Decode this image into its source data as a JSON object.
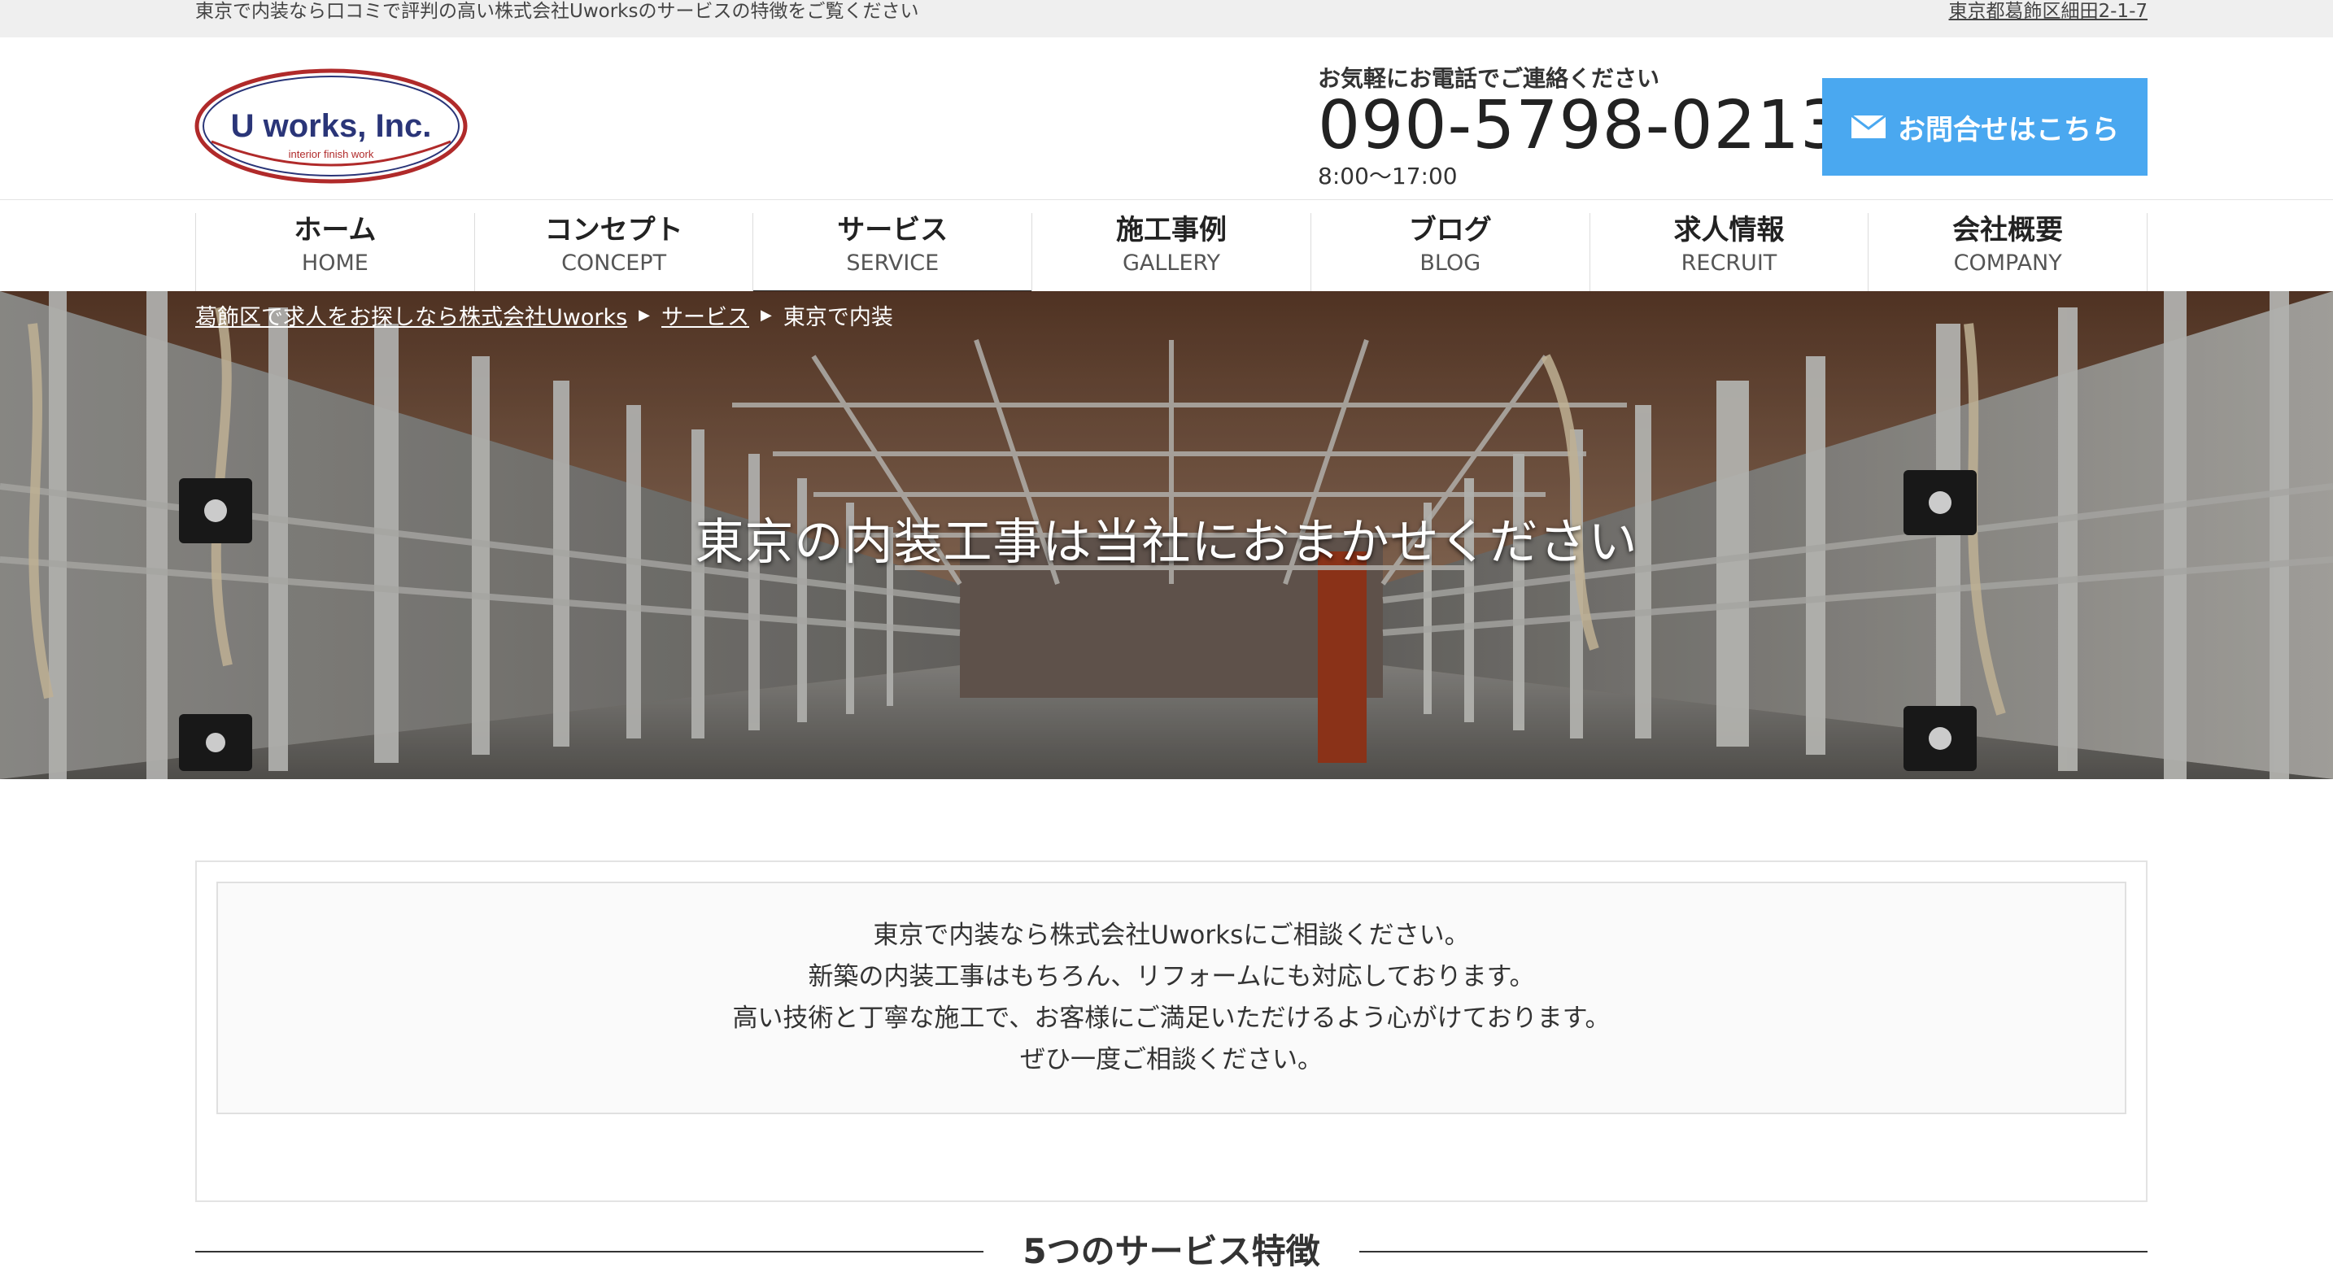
{
  "topbar": {
    "tagline": "東京で内装なら口コミで評判の高い株式会社Uworksのサービスの特徴をご覧ください",
    "address": "東京都葛飾区細田2-1-7"
  },
  "header": {
    "logo": {
      "name": "U works, Inc.",
      "sub": "interior finish work"
    },
    "contact_lead": "お気軽にお電話でご連絡ください",
    "phone": "090-5798-0213",
    "hours": "8:00〜17:00",
    "inquiry_button": "お問合せはこちら"
  },
  "nav": {
    "items": [
      {
        "ja": "ホーム",
        "en": "HOME"
      },
      {
        "ja": "コンセプト",
        "en": "CONCEPT"
      },
      {
        "ja": "サービス",
        "en": "SERVICE"
      },
      {
        "ja": "施工事例",
        "en": "GALLERY"
      },
      {
        "ja": "ブログ",
        "en": "BLOG"
      },
      {
        "ja": "求人情報",
        "en": "RECRUIT"
      },
      {
        "ja": "会社概要",
        "en": "COMPANY"
      }
    ]
  },
  "breadcrumb": {
    "home": "葛飾区で求人をお探しなら株式会社Uworks",
    "parent": "サービス",
    "current": "東京で内装"
  },
  "hero": {
    "title": "東京の内装工事は当社におまかせください"
  },
  "intro": {
    "lines": [
      "東京で内装なら株式会社Uworksにご相談ください。",
      "新築の内装工事はもちろん、リフォームにも対応しております。",
      "高い技術と丁寧な施工で、お客様にご満足いただけるよう心がけております。",
      "ぜひ一度ご相談ください。"
    ]
  },
  "section": {
    "heading": "5つのサービス特徴"
  },
  "colors": {
    "accent_button": "#4aa8f0",
    "logo_red": "#b02a2a",
    "logo_navy": "#2a3578",
    "topbar_bg": "#efefef"
  }
}
